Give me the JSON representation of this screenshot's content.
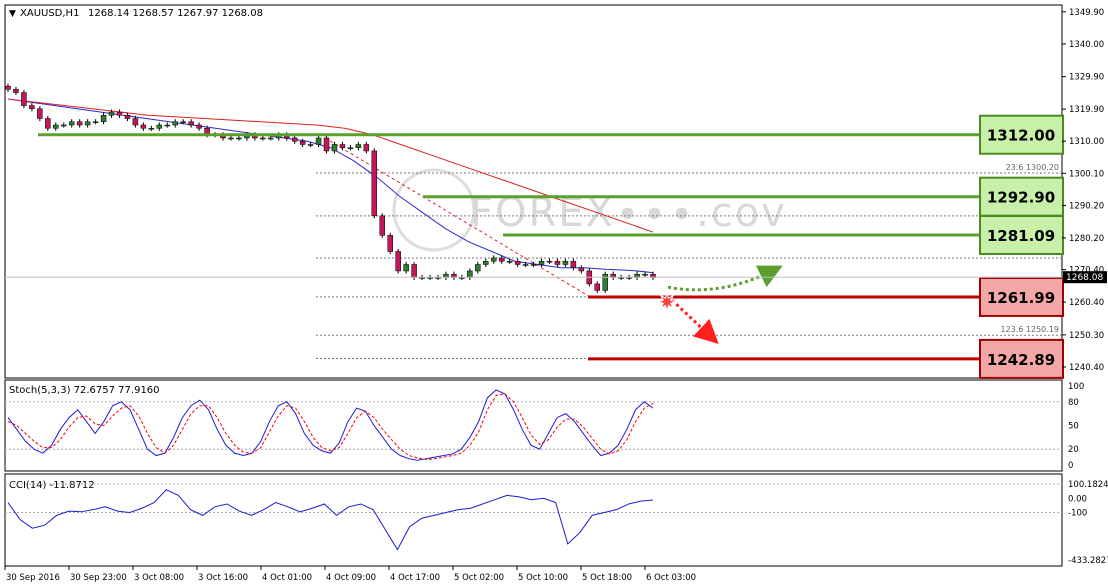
{
  "header": {
    "symbol": "XAUUSD,H1",
    "ohlc": "1268.14 1268.57 1267.97 1268.08"
  },
  "watermark": "FOREX∙∙∙.cov",
  "current_price_label": "1268.08",
  "colors": {
    "candle_up": "#2e7d32",
    "candle_down": "#c2185b",
    "ma_fast": "#2b2bd0",
    "ma_slow": "#e02020",
    "support_green": "#5aa02c",
    "resistance_red": "#c00000",
    "box_green_fill": "#c8f0a8",
    "box_red_fill": "#f4a7a7",
    "stoch_main": "#1c1cd4",
    "stoch_signal": "#ff0000",
    "cci": "#1c1cd4"
  },
  "chart_data": [
    {
      "type": "line",
      "title": "XAUUSD,H1",
      "ylim": [
        1237,
        1352
      ],
      "y_ticks": [
        1349.9,
        1340.0,
        1329.9,
        1319.9,
        1310.0,
        1300.1,
        1290.2,
        1280.2,
        1270.4,
        1260.4,
        1250.3,
        1240.4
      ],
      "y_tick_labels": [
        "1349.90",
        "1340.00",
        "1329.90",
        "1319.90",
        "1310.00",
        "1300.10",
        "1290.20",
        "1280.20",
        "1270.40",
        "1260.40",
        "1250.30",
        "1240.40"
      ],
      "x_tick_labels": [
        "30 Sep 2016",
        "30 Sep 23:00",
        "3 Oct 08:00",
        "3 Oct 16:00",
        "4 Oct 01:00",
        "4 Oct 09:00",
        "4 Oct 17:00",
        "5 Oct 02:00",
        "5 Oct 10:00",
        "5 Oct 18:00",
        "6 Oct 03:00"
      ],
      "close_series": [
        1326,
        1325,
        1321,
        1320,
        1317,
        1314,
        1315,
        1315,
        1316,
        1315,
        1316,
        1316,
        1318,
        1319,
        1318,
        1317,
        1315,
        1314,
        1314,
        1315,
        1315,
        1316,
        1316,
        1315,
        1314,
        1312,
        1312,
        1311,
        1311,
        1311,
        1312,
        1311,
        1311,
        1311,
        1312,
        1311,
        1310,
        1309,
        1309,
        1311,
        1307,
        1309,
        1308,
        1308,
        1309,
        1307,
        1287,
        1281,
        1276,
        1270,
        1272,
        1268,
        1268,
        1268,
        1268,
        1269,
        1268,
        1268,
        1270,
        1272,
        1273,
        1274,
        1273,
        1273,
        1272,
        1272,
        1272,
        1273,
        1273,
        1272,
        1273,
        1271,
        1270,
        1266,
        1264,
        1269,
        1268,
        1268,
        1268,
        1269,
        1269,
        1268
      ],
      "moving_averages": [
        {
          "values": [
            1323,
            1322,
            1321,
            1320,
            1319,
            1318,
            1317,
            1316,
            1315,
            1314,
            1313,
            1312,
            1311,
            1310,
            1308,
            1304,
            1299,
            1293,
            1288,
            1283,
            1279,
            1276,
            1273,
            1272,
            1271,
            1271,
            1270.5,
            1270.2,
            1269.5
          ]
        },
        {
          "values": [
            1323,
            1322,
            1321,
            1320,
            1319,
            1318,
            1317.5,
            1317,
            1316.5,
            1316,
            1315.5,
            1315,
            1314,
            1312,
            1309,
            1306,
            1303,
            1300,
            1297,
            1294,
            1291,
            1288,
            1285,
            1282
          ]
        }
      ],
      "level_boxes": [
        {
          "label": "1312.00",
          "value": 1312.0,
          "kind": "support"
        },
        {
          "label": "1292.90",
          "value": 1292.9,
          "kind": "support"
        },
        {
          "label": "1281.09",
          "value": 1281.09,
          "kind": "support"
        },
        {
          "label": "1261.99",
          "value": 1261.99,
          "kind": "resistance"
        },
        {
          "label": "1242.89",
          "value": 1242.89,
          "kind": "resistance"
        }
      ],
      "fibonacci_labels": [
        {
          "text": "23.6  1300.20",
          "value": 1300.2
        },
        {
          "text": "123.6  1250.19",
          "value": 1250.19
        }
      ],
      "fib_levels": [
        1300.2,
        1287.0,
        1274.0,
        1262.0,
        1250.19,
        1243.0
      ]
    },
    {
      "type": "line",
      "title": "Stoch(5,3,3) 72.6757 77.9160",
      "ylim": [
        0,
        100
      ],
      "y_tick_labels": [
        "100",
        "80",
        "50",
        "20",
        "0"
      ],
      "y_ticks": [
        100,
        80,
        50,
        20,
        0
      ],
      "series": [
        {
          "values": [
            60,
            45,
            30,
            20,
            15,
            25,
            45,
            60,
            70,
            55,
            40,
            55,
            75,
            80,
            70,
            45,
            20,
            12,
            15,
            35,
            60,
            75,
            82,
            70,
            45,
            25,
            15,
            12,
            15,
            30,
            55,
            75,
            80,
            65,
            40,
            25,
            18,
            15,
            28,
            55,
            72,
            68,
            50,
            35,
            20,
            12,
            8,
            6,
            8,
            10,
            12,
            14,
            20,
            35,
            55,
            85,
            95,
            90,
            70,
            45,
            25,
            20,
            40,
            60,
            65,
            55,
            40,
            25,
            12,
            15,
            25,
            45,
            70,
            80,
            72
          ]
        },
        {
          "values": [
            55,
            50,
            40,
            30,
            22,
            22,
            32,
            48,
            60,
            62,
            52,
            50,
            62,
            72,
            75,
            62,
            40,
            22,
            15,
            25,
            45,
            65,
            75,
            75,
            60,
            40,
            25,
            16,
            15,
            22,
            42,
            62,
            75,
            72,
            55,
            35,
            22,
            18,
            22,
            40,
            60,
            68,
            60,
            45,
            32,
            20,
            12,
            9,
            7,
            8,
            10,
            12,
            15,
            25,
            42,
            70,
            88,
            90,
            80,
            60,
            38,
            26,
            32,
            48,
            58,
            58,
            48,
            34,
            20,
            14,
            18,
            32,
            55,
            72,
            78
          ]
        }
      ]
    },
    {
      "type": "line",
      "title": "CCI(14) -11.8712",
      "y_tick_labels": [
        "100.1824",
        "0.00",
        "-100",
        "-433.2827"
      ],
      "y_ticks": [
        100.1824,
        0,
        -100,
        -433.2827
      ],
      "ylim": [
        -433.2827,
        100.1824
      ],
      "series": [
        {
          "values": [
            -30,
            -150,
            -210,
            -190,
            -120,
            -90,
            -95,
            -80,
            -60,
            -90,
            -100,
            -70,
            -30,
            60,
            20,
            -80,
            -120,
            -60,
            -40,
            -90,
            -120,
            -80,
            -30,
            -60,
            -95,
            -70,
            -40,
            -120,
            -60,
            -40,
            -80,
            -220,
            -360,
            -200,
            -140,
            -120,
            -100,
            -80,
            -70,
            -40,
            -10,
            20,
            10,
            -10,
            0,
            -30,
            -320,
            -240,
            -120,
            -100,
            -80,
            -40,
            -20,
            -11.87
          ]
        }
      ]
    }
  ]
}
